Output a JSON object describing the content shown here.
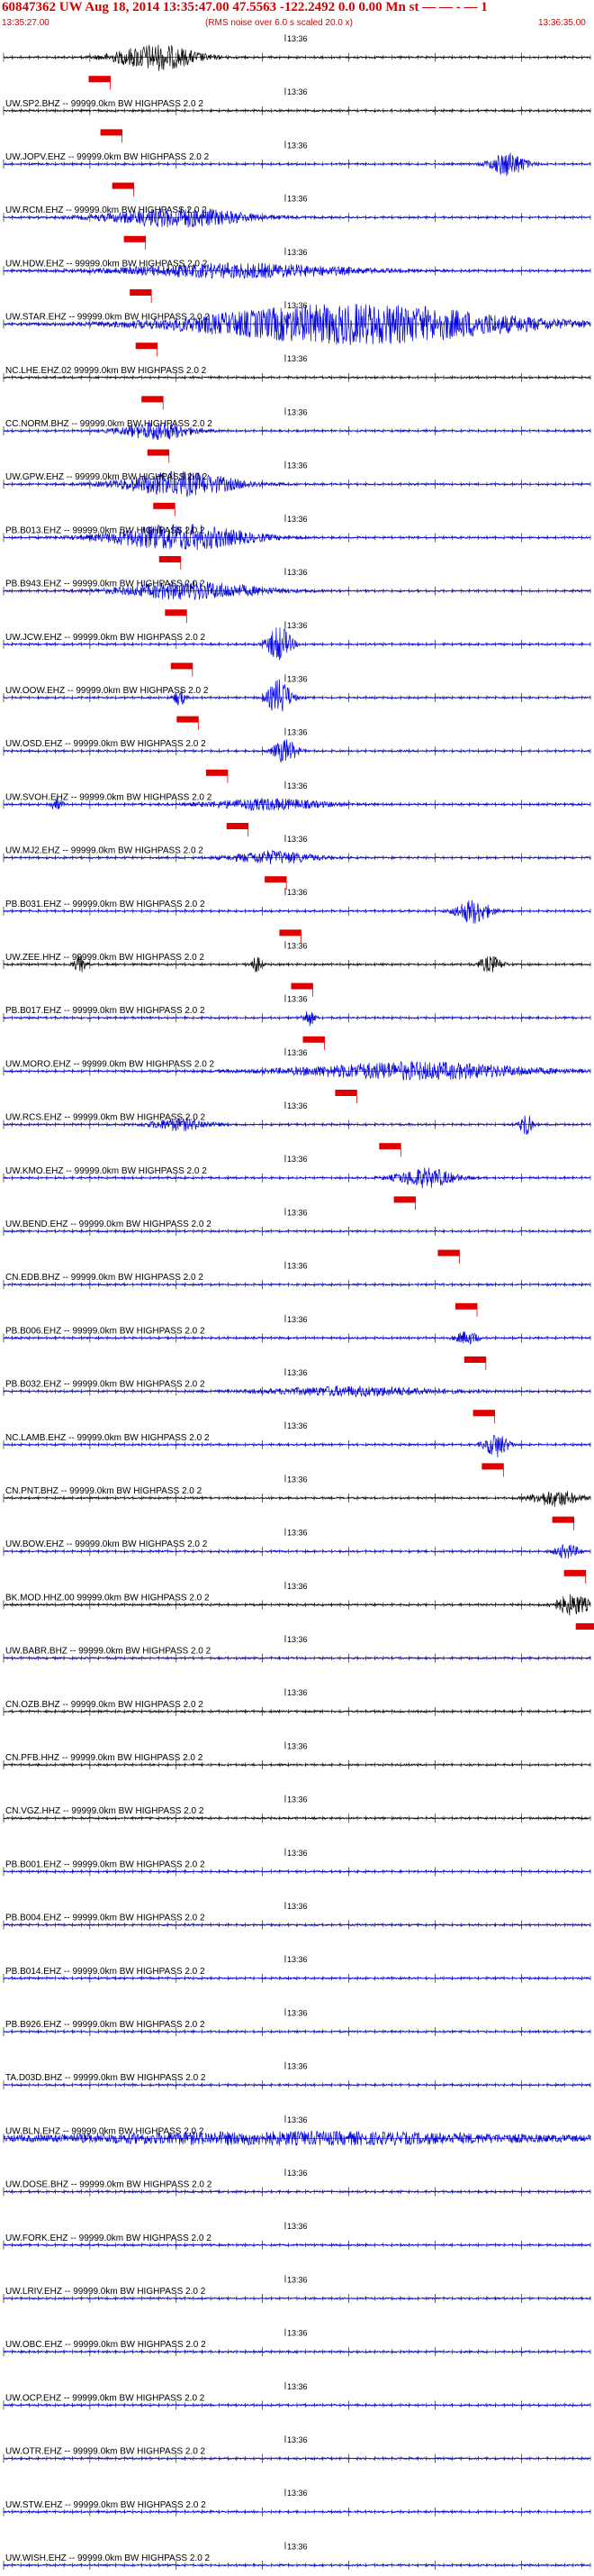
{
  "header": {
    "title": "60847362 UW Aug 18, 2014 13:35:47.00   47.5563 -122.2492  0.0 0.00 Mn st — — -  — 1",
    "start_time": "13:35:27.00",
    "rms_note": "(RMS noise over 6.0 s scaled 20.0 x)",
    "end_time": "13:36:35.00"
  },
  "time_marker": "13:36",
  "colors": {
    "blue": "#0000e0",
    "black": "#000000",
    "red": "#e00000",
    "pick_fill": "#e00000"
  },
  "traces": [
    {
      "label": "",
      "color": "black",
      "pick": 0.145,
      "events": [
        [
          0.26,
          0.07,
          3.2
        ]
      ]
    },
    {
      "label": "UW.SP2.BHZ -- 99999.0km BW  HIGHPASS  2.0  2",
      "color": "black",
      "pick": 0.165,
      "events": []
    },
    {
      "label": "UW.JOPV.EHZ -- 99999.0km BW  HIGHPASS  2.0  2",
      "color": "blue",
      "pick": 0.185,
      "events": [
        [
          0.86,
          0.03,
          3.0
        ]
      ]
    },
    {
      "label": "UW.RCM.EHZ -- 99999.0km BW  HIGHPASS  2.0  2",
      "color": "blue",
      "pick": 0.205,
      "events": [
        [
          0.3,
          0.12,
          2.4
        ]
      ]
    },
    {
      "label": "UW.HDW.EHZ -- 99999.0km BW  HIGHPASS  2.0  2",
      "color": "blue",
      "pick": 0.215,
      "events": [
        [
          0.4,
          0.2,
          1.8
        ]
      ]
    },
    {
      "label": "UW.STAR.EHZ -- 99999.0km BW  HIGHPASS  2.0  2",
      "color": "blue",
      "pick": 0.225,
      "events": [
        [
          0.6,
          0.28,
          5.0
        ]
      ]
    },
    {
      "label": "NC.LHE.EHZ.02 99999.0km BW  HIGHPASS  2.0  2",
      "color": "black",
      "pick": 0.235,
      "events": []
    },
    {
      "label": "CC.NORM.BHZ -- 99999.0km BW  HIGHPASS  2.0  2",
      "color": "blue",
      "pick": 0.245,
      "events": [
        [
          0.26,
          0.06,
          2.2
        ]
      ]
    },
    {
      "label": "UW.GPW.EHZ -- 99999.0km BW  HIGHPASS  2.0  2",
      "color": "blue",
      "pick": 0.255,
      "events": [
        [
          0.3,
          0.1,
          3.0
        ]
      ]
    },
    {
      "label": "PB.B013.EHZ -- 99999.0km BW  HIGHPASS  2.0  2",
      "color": "blue",
      "pick": 0.265,
      "events": [
        [
          0.3,
          0.12,
          3.2
        ]
      ]
    },
    {
      "label": "PB.B943.EHZ -- 99999.0km BW  HIGHPASS  2.0  2",
      "color": "blue",
      "pick": 0.275,
      "events": [
        [
          0.32,
          0.12,
          2.2
        ]
      ]
    },
    {
      "label": "UW.JCW.EHZ -- 99999.0km BW  HIGHPASS  2.0  2",
      "color": "blue",
      "pick": 0.285,
      "events": [
        [
          0.47,
          0.02,
          4.5
        ]
      ]
    },
    {
      "label": "UW.OOW.EHZ -- 99999.0km BW  HIGHPASS  2.0  2",
      "color": "blue",
      "pick": 0.295,
      "events": [
        [
          0.47,
          0.02,
          4.5
        ],
        [
          0.3,
          0.01,
          2.0
        ]
      ]
    },
    {
      "label": "UW.OSD.EHZ -- 99999.0km BW  HIGHPASS  2.0  2",
      "color": "blue",
      "pick": 0.345,
      "events": [
        [
          0.48,
          0.02,
          3.0
        ]
      ]
    },
    {
      "label": "UW.SVOH.EHZ -- 99999.0km BW  HIGHPASS  2.0  2",
      "color": "blue",
      "pick": 0.38,
      "events": [
        [
          0.09,
          0.01,
          1.6
        ],
        [
          0.45,
          0.1,
          1.4
        ]
      ]
    },
    {
      "label": "UW.MJ2.EHZ -- 99999.0km BW  HIGHPASS  2.0  2",
      "color": "blue",
      "pick": 0.445,
      "events": [
        [
          0.46,
          0.07,
          1.6
        ]
      ]
    },
    {
      "label": "PB.B031.EHZ -- 99999.0km BW  HIGHPASS  2.0  2",
      "color": "blue",
      "pick": 0.47,
      "events": [
        [
          0.8,
          0.03,
          3.0
        ]
      ]
    },
    {
      "label": "UW.ZEE.HHZ -- 99999.0km BW  HIGHPASS  2.0  2",
      "color": "black",
      "pick": 0.49,
      "events": [
        [
          0.13,
          0.01,
          2.0
        ],
        [
          0.43,
          0.01,
          2.0
        ],
        [
          0.83,
          0.02,
          2.0
        ]
      ]
    },
    {
      "label": "PB.B017.EHZ -- 99999.0km BW  HIGHPASS  2.0  2",
      "color": "blue",
      "pick": 0.51,
      "events": [
        [
          0.52,
          0.01,
          2.0
        ]
      ]
    },
    {
      "label": "UW.MORO.EHZ -- 99999.0km BW  HIGHPASS  2.0  2",
      "color": "blue",
      "pick": 0.565,
      "events": [
        [
          0.7,
          0.2,
          2.2
        ]
      ]
    },
    {
      "label": "UW.RCS.EHZ -- 99999.0km BW  HIGHPASS  2.0  2",
      "color": "blue",
      "pick": 0.64,
      "events": [
        [
          0.89,
          0.01,
          3.0
        ],
        [
          0.3,
          0.05,
          1.5
        ]
      ]
    },
    {
      "label": "UW.KMO.EHZ -- 99999.0km BW  HIGHPASS  2.0  2",
      "color": "blue",
      "pick": 0.665,
      "events": [
        [
          0.72,
          0.05,
          2.4
        ]
      ]
    },
    {
      "label": "UW.BEND.EHZ -- 99999.0km BW  HIGHPASS  2.0  2",
      "color": "blue",
      "pick": 0.74,
      "events": []
    },
    {
      "label": "CN.EDB.BHZ -- 99999.0km BW  HIGHPASS  2.0  2",
      "color": "blue",
      "pick": 0.77,
      "events": []
    },
    {
      "label": "PB.B006.EHZ -- 99999.0km BW  HIGHPASS  2.0  2",
      "color": "blue",
      "pick": 0.785,
      "events": [
        [
          0.79,
          0.02,
          1.6
        ]
      ]
    },
    {
      "label": "PB.B032.EHZ -- 99999.0km BW  HIGHPASS  2.0  2",
      "color": "blue",
      "pick": 0.8,
      "events": [
        [
          0.6,
          0.15,
          1.2
        ]
      ]
    },
    {
      "label": "NC.LAMB.EHZ -- 99999.0km BW  HIGHPASS  2.0  2",
      "color": "blue",
      "pick": 0.815,
      "events": [
        [
          0.84,
          0.02,
          3.0
        ]
      ]
    },
    {
      "label": "CN.PNT.BHZ -- 99999.0km BW  HIGHPASS  2.0  2",
      "color": "black",
      "pick": 0.935,
      "events": [
        [
          0.94,
          0.04,
          2.0
        ]
      ]
    },
    {
      "label": "UW.BOW.EHZ -- 99999.0km BW  HIGHPASS  2.0  2",
      "color": "blue",
      "pick": 0.955,
      "events": [
        [
          0.96,
          0.02,
          1.8
        ]
      ]
    },
    {
      "label": "BK.MOD.HHZ.00 99999.0km BW  HIGHPASS  2.0  2",
      "color": "black",
      "pick": 0.975,
      "events": [
        [
          0.97,
          0.03,
          2.6
        ]
      ]
    },
    {
      "label": "UW.BABR.BHZ -- 99999.0km BW  HIGHPASS  2.0  2",
      "color": "blue",
      "pick": null,
      "events": []
    },
    {
      "label": "CN.OZB.BHZ -- 99999.0km BW  HIGHPASS  2.0  2",
      "color": "black",
      "pick": null,
      "events": []
    },
    {
      "label": "CN.PFB.HHZ -- 99999.0km BW  HIGHPASS  2.0  2",
      "color": "black",
      "pick": null,
      "events": []
    },
    {
      "label": "CN.VGZ.HHZ -- 99999.0km BW  HIGHPASS  2.0  2",
      "color": "black",
      "pick": null,
      "events": []
    },
    {
      "label": "PB.B001.EHZ -- 99999.0km BW  HIGHPASS  2.0  2",
      "color": "blue",
      "pick": null,
      "events": []
    },
    {
      "label": "PB.B004.EHZ -- 99999.0km BW  HIGHPASS  2.0  2",
      "color": "blue",
      "pick": null,
      "events": []
    },
    {
      "label": "PB.B014.EHZ -- 99999.0km BW  HIGHPASS  2.0  2",
      "color": "blue",
      "pick": null,
      "events": []
    },
    {
      "label": "PB.B926.EHZ -- 99999.0km BW  HIGHPASS  2.0  2",
      "color": "blue",
      "pick": null,
      "events": []
    },
    {
      "label": "TA.D03D.BHZ -- 99999.0km BW  HIGHPASS  2.0  2",
      "color": "blue",
      "pick": null,
      "events": []
    },
    {
      "label": "UW.BLN.EHZ -- 99999.0km BW  HIGHPASS  2.0  2",
      "color": "blue",
      "pick": null,
      "events": [
        [
          0.5,
          0.5,
          1.6
        ]
      ]
    },
    {
      "label": "UW.DOSE.BHZ -- 99999.0km BW  HIGHPASS  2.0  2",
      "color": "blue",
      "pick": null,
      "events": []
    },
    {
      "label": "UW.FORK.EHZ -- 99999.0km BW  HIGHPASS  2.0  2",
      "color": "blue",
      "pick": null,
      "events": []
    },
    {
      "label": "UW.LRIV.EHZ -- 99999.0km BW  HIGHPASS  2.0  2",
      "color": "blue",
      "pick": null,
      "events": []
    },
    {
      "label": "UW.OBC.EHZ -- 99999.0km BW  HIGHPASS  2.0  2",
      "color": "blue",
      "pick": null,
      "events": []
    },
    {
      "label": "UW.OCP.EHZ -- 99999.0km BW  HIGHPASS  2.0  2",
      "color": "blue",
      "pick": null,
      "events": []
    },
    {
      "label": "UW.OTR.EHZ -- 99999.0km BW  HIGHPASS  2.0  2",
      "color": "blue",
      "pick": null,
      "events": []
    },
    {
      "label": "UW.STW.EHZ -- 99999.0km BW  HIGHPASS  2.0  2",
      "color": "blue",
      "pick": null,
      "events": []
    },
    {
      "label": "UW.WISH.EHZ -- 99999.0km BW  HIGHPASS  2.0  2",
      "color": "blue",
      "pick": null,
      "events": []
    }
  ]
}
